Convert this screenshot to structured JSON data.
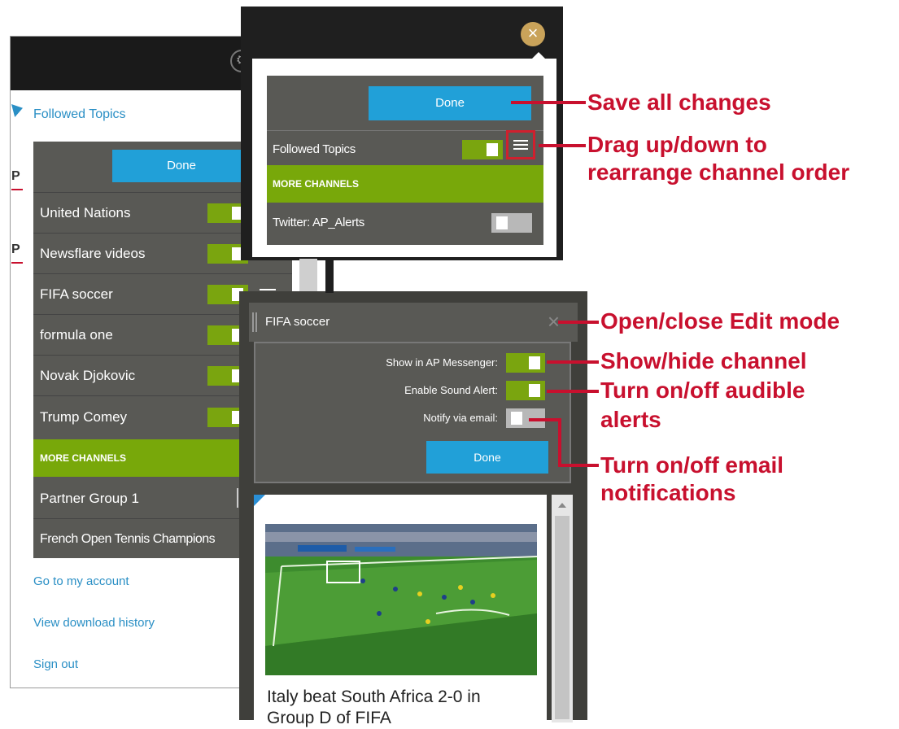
{
  "panel_a": {
    "section_title": "Followed Topics",
    "done_label": "Done",
    "channels": [
      {
        "label": "United Nations",
        "on": true
      },
      {
        "label": "Newsflare videos",
        "on": true
      },
      {
        "label": "FIFA soccer",
        "on": true
      },
      {
        "label": "formula one",
        "on": true
      },
      {
        "label": "Novak Djokovic",
        "on": true
      },
      {
        "label": "Trump Comey",
        "on": true
      }
    ],
    "more_channels_label": "MORE CHANNELS",
    "more_channels": [
      {
        "label": "Partner Group 1"
      },
      {
        "label": "French Open Tennis Champions"
      }
    ],
    "links": [
      "Go to my account",
      "View download history",
      "Sign out"
    ],
    "side_letters": [
      "P",
      "P"
    ]
  },
  "panel_b": {
    "done_label": "Done",
    "row_label": "Followed Topics",
    "row_on": true,
    "more_channels_label": "MORE CHANNELS",
    "twitter_label": "Twitter: AP_Alerts",
    "twitter_on": false
  },
  "panel_c": {
    "title": "FIFA soccer",
    "settings": [
      {
        "label": "Show in AP Messenger:",
        "on": true
      },
      {
        "label": "Enable Sound Alert:",
        "on": true
      },
      {
        "label": "Notify via email:",
        "on": false
      }
    ],
    "done_label": "Done",
    "headline": "Italy beat South Africa 2-0 in Group D of FIFA"
  },
  "annotations": {
    "save": "Save all changes",
    "drag_line1": "Drag up/down to",
    "drag_line2": "rearrange channel order",
    "edit": "Open/close Edit mode",
    "show": "Show/hide channel",
    "audible_line1": "Turn on/off audible",
    "audible_line2": "alerts",
    "email_line1": "Turn on/off email",
    "email_line2": "notifications"
  },
  "colors": {
    "accent_blue": "#21a0d8",
    "toggle_green": "#7aa50f",
    "annotation_red": "#c8102e",
    "panel_gray": "#595955"
  }
}
